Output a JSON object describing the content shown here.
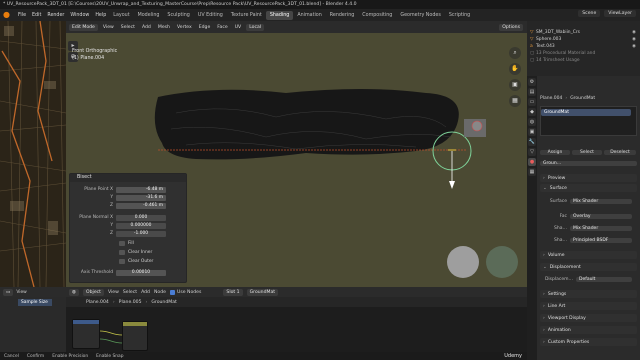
{
  "window": {
    "title": "* UV_ResourcePack_3DT_01 [E:\\Courses\\20UV_Unwrap_and_Texturing_MasterCourse\\Prep\\Resource Pack\\UV_ResourcePack_3DT_01.blend] - Blender 4.4.0"
  },
  "menubar": {
    "menus": [
      "File",
      "Edit",
      "Render",
      "Window",
      "Help"
    ],
    "workspaces": [
      "Layout",
      "Modeling",
      "Sculpting",
      "UV Editing",
      "Texture Paint",
      "Shading",
      "Animation",
      "Rendering",
      "Compositing",
      "Geometry Nodes",
      "Scripting"
    ],
    "active_workspace": "Shading",
    "scene": "Scene",
    "view_layer": "ViewLayer"
  },
  "viewport": {
    "mode": "Edit Mode",
    "menus": [
      "View",
      "Select",
      "Add",
      "Mesh",
      "Vertex",
      "Edge",
      "Face",
      "UV"
    ],
    "orientation": "Local",
    "options_label": "Options",
    "info_line1": "Front Orthographic",
    "info_line2": "(1) Plane.004"
  },
  "bisect_panel": {
    "title": "Bisect",
    "plane_point_label": "Plane Point X",
    "plane_point": {
      "x": "-6.48 m",
      "y": "-31.6 m",
      "z": "-0.461 m"
    },
    "plane_normal_label": "Plane Normal X",
    "plane_normal": {
      "x": "0.000",
      "y": "0.000000",
      "z": "-1.000"
    },
    "axis_label_y": "Y",
    "axis_label_z": "Z",
    "fill_label": "Fill",
    "clear_inner_label": "Clear Inner",
    "clear_outer_label": "Clear Outer",
    "axis_threshold_label": "Axis Threshold",
    "axis_threshold": "0.00010"
  },
  "outliner": {
    "items": [
      "SM_3DT_Wabiin_Crs",
      "Sphere.003",
      "Text.043",
      "13 Procedural Material and",
      "14 Trimsheet Usage"
    ]
  },
  "properties": {
    "object_name": "Plane.004",
    "material_name": "GroundMat",
    "slot_name": "GroundMat",
    "assign": "Assign",
    "select": "Select",
    "deselect": "Deselect",
    "material_field": "Groun…",
    "sections": {
      "preview": "Preview",
      "surface": "Surface",
      "volume": "Volume",
      "displacement": "Displacement",
      "settings": "Settings",
      "line_art": "Line Art",
      "viewport_display": "Viewport Display",
      "animation": "Animation",
      "custom_properties": "Custom Properties"
    },
    "surface_label": "Surface",
    "surface_value": "Mix Shader",
    "fac_label": "Fac",
    "fac_value": "Overlay",
    "sha1_label": "Sha…",
    "sha1_value": "Mix Shader",
    "sha2_label": "Sha…",
    "sha2_value": "Principled BSDF",
    "displacement_label": "Displacem…",
    "displacement_value": "Default"
  },
  "node_editor": {
    "view": "View",
    "object_mode": "Object",
    "menus": [
      "View",
      "Select",
      "Add",
      "Node"
    ],
    "use_nodes": "Use Nodes",
    "slot": "Slot 1",
    "material": "GroundMat",
    "breadcrumb_object": "Plane.004",
    "breadcrumb_mesh": "Plane.005",
    "breadcrumb_material": "GroundMat"
  },
  "left_panel": {
    "view": "View",
    "sample_size": "Sample Size"
  },
  "statusbar": {
    "items": [
      "Cancel",
      "Confirm",
      "Enable Precision",
      "Enable Snap"
    ]
  },
  "watermark": "Udemy"
}
